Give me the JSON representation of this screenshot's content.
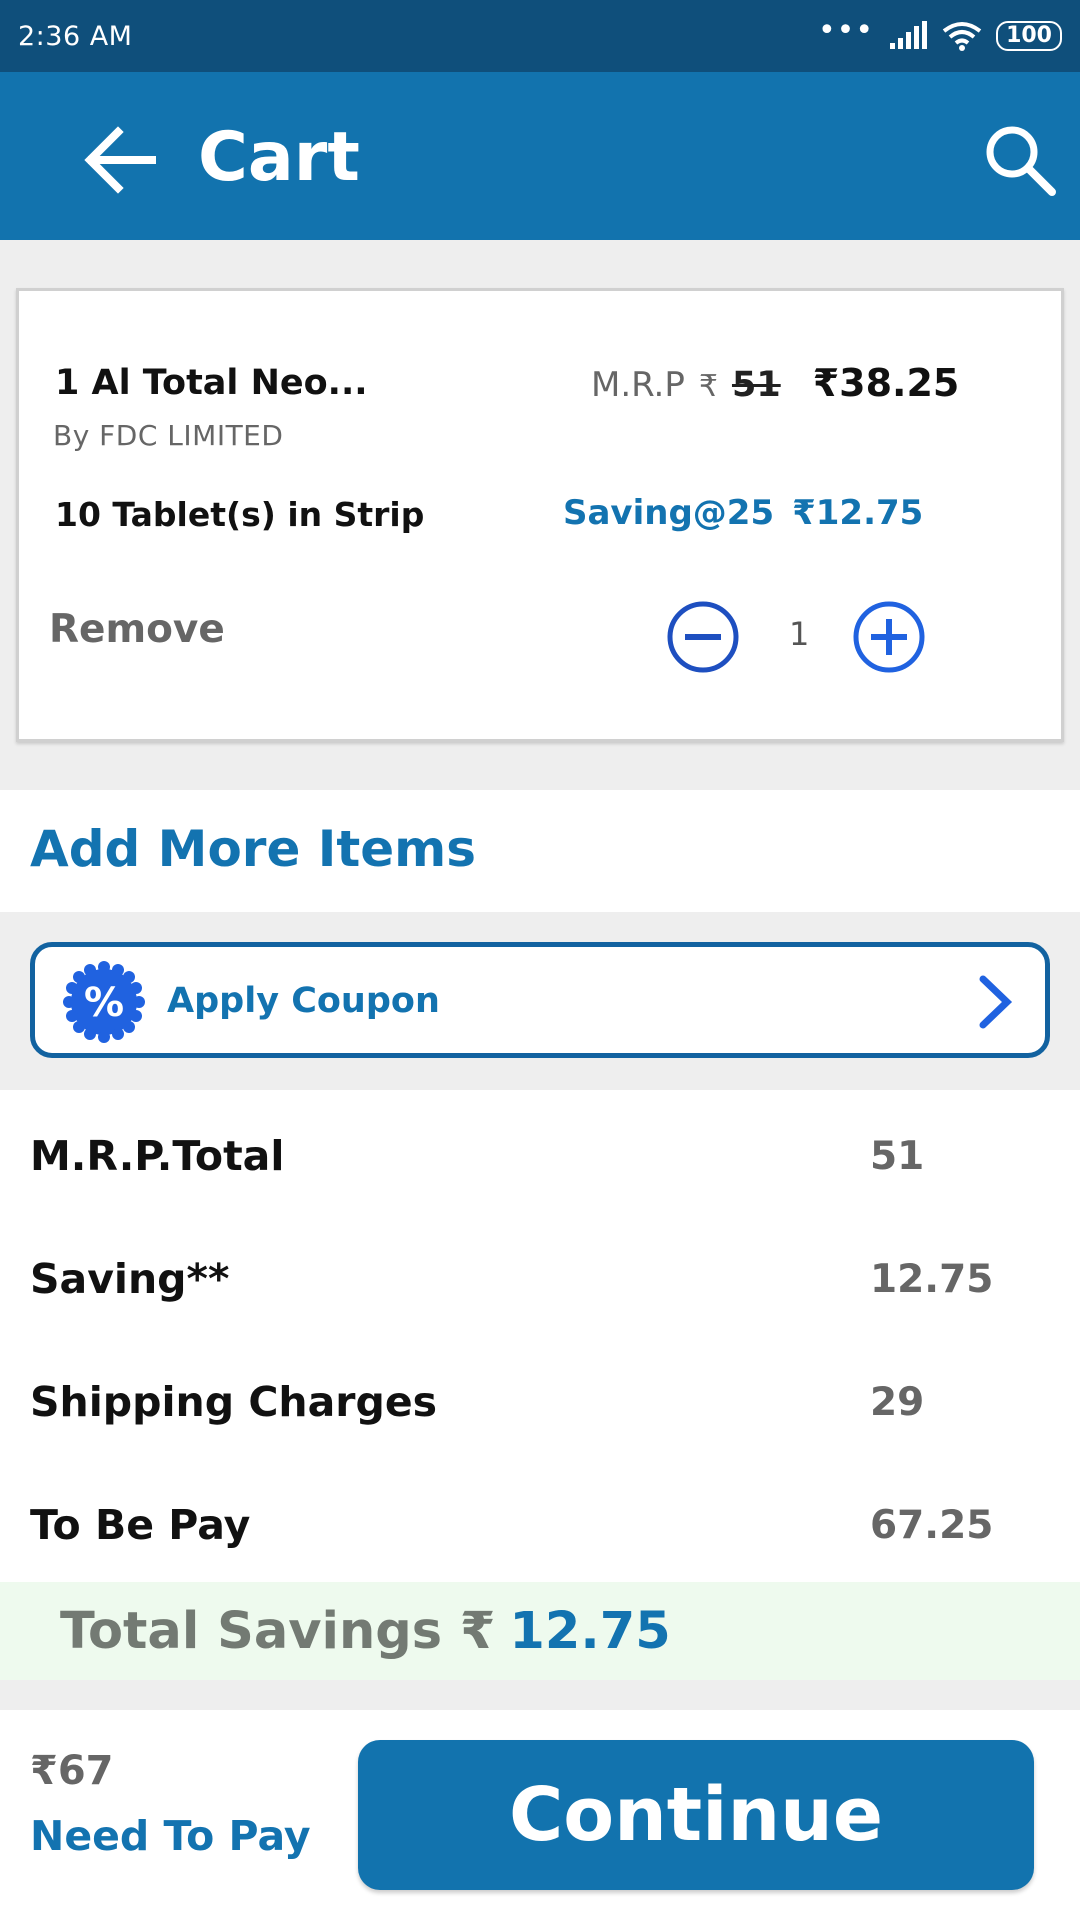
{
  "status_bar": {
    "time": "2:36 AM",
    "battery": "100"
  },
  "app_bar": {
    "title": "Cart",
    "back_icon": "arrow-left-icon",
    "search_icon": "search-icon"
  },
  "cart_item": {
    "name": "1 Al Total Neo...",
    "manufacturer": "By FDC LIMITED",
    "pack": "10 Tablet(s) in Strip",
    "mrp_label": "M.R.P",
    "currency": "₹",
    "mrp": "51",
    "price": "₹38.25",
    "saving_label": "Saving@25",
    "saving_amount": "₹12.75",
    "remove_label": "Remove",
    "quantity": "1"
  },
  "add_more": {
    "label": "Add More Items"
  },
  "coupon": {
    "label": "Apply Coupon",
    "badge_symbol": "%"
  },
  "summary": {
    "rows": [
      {
        "label": "M.R.P.Total",
        "value": "51"
      },
      {
        "label": "Saving**",
        "value": "12.75"
      },
      {
        "label": "Shipping Charges",
        "value": "29"
      },
      {
        "label": "To Be Pay",
        "value": "67.25"
      }
    ]
  },
  "total_savings": {
    "label": "Total Savings ₹",
    "amount": "12.75"
  },
  "bottom_bar": {
    "amount": "₹67",
    "label": "Need To Pay",
    "continue_label": "Continue"
  },
  "colors": {
    "primary": "#1273ae",
    "status_bar": "#0f4f7b",
    "accent_blue": "#1373b0",
    "icon_blue": "#2062e0",
    "savings_bg": "#eefaee"
  }
}
